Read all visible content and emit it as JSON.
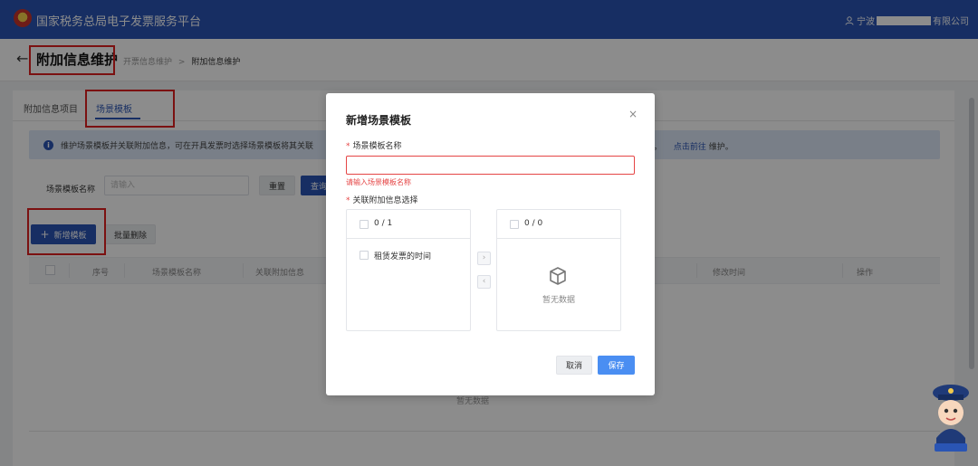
{
  "header": {
    "app_title": "国家税务总局电子发票服务平台",
    "user_prefix": "宁波",
    "user_suffix": "有限公司"
  },
  "subheader": {
    "back_icon": "arrow-left-icon",
    "page_title": "附加信息维护",
    "breadcrumb": [
      "开票信息维护",
      "附加信息维护"
    ],
    "breadcrumb_sep": ">"
  },
  "tabs": [
    {
      "label": "附加信息项目",
      "active": false
    },
    {
      "label": "场景模板",
      "active": true
    }
  ],
  "notice": {
    "text": "维护场景模板并关联附加信息，可在开具发票时选择场景模板将其关联",
    "tail_text": "。",
    "link": "点击前往",
    "tail_after_link": "维护。"
  },
  "filter": {
    "label": "场景模板名称",
    "placeholder": "请输入",
    "reset_label": "重置",
    "query_label": "查询"
  },
  "actions": {
    "add_label": "新增模板",
    "batch_delete_label": "批量删除"
  },
  "table": {
    "columns": [
      "序号",
      "场景模板名称",
      "关联附加信息",
      "修改时间",
      "操作"
    ],
    "empty_text": "暂无数据"
  },
  "modal": {
    "title": "新增场景模板",
    "name_label": "场景模板名称",
    "name_value": "",
    "name_error": "请输入场景模板名称",
    "relate_label": "关联附加信息选择",
    "left_panel": {
      "count": "0 / 1",
      "items": [
        "租赁发票的时间"
      ]
    },
    "right_panel": {
      "count": "0 / 0",
      "empty_text": "暂无数据"
    },
    "to_right": "›",
    "to_left": "‹",
    "cancel_label": "取消",
    "save_label": "保存",
    "close_glyph": "×"
  },
  "colors": {
    "brand": "#2a55b4",
    "accent": "#4a8ef2",
    "error": "#e54545",
    "highlight": "#e02020"
  }
}
